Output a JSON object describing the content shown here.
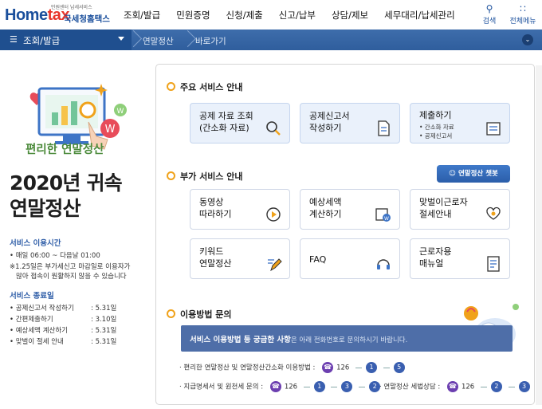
{
  "header": {
    "logo_tagline": "민원센터 납세서비스",
    "logo_brand_main": "Home",
    "logo_brand_accent": "tax",
    "logo_kr": "국세청홈택스",
    "menus": [
      "조회/발급",
      "민원증명",
      "신청/제출",
      "신고/납부",
      "상담/제보",
      "세무대리/납세관리"
    ],
    "search_label": "검색",
    "allmenu_label": "전체메뉴"
  },
  "nav": {
    "menu_label": "조회/발급",
    "crumb1": "연말정산",
    "crumb2": "바로가기"
  },
  "left": {
    "subtitle": "편리한 연말정산",
    "title_line1": "2020년 귀속",
    "title_line2": "연말정산",
    "service_hours_head": "서비스 이용시간",
    "hours": "• 매일 06:00 ~ 다음날 01:00",
    "note1": "※1.25일은 부가세신고 마감일로 이용자가",
    "note2": "많아 접속이 원활하지 않을 수 있습니다",
    "end_head": "서비스 종료일",
    "end_items": [
      {
        "label": "• 공제신고서 작성하기",
        "value": ": 5.31일"
      },
      {
        "label": "• 간편제출하기",
        "value": ": 3.10일"
      },
      {
        "label": "• 예상세액 계산하기",
        "value": ": 5.31일"
      },
      {
        "label": "• 맞벌이 절세 안내",
        "value": ": 5.31일"
      }
    ]
  },
  "main": {
    "sec1": "주요 서비스 안내",
    "cards1": [
      {
        "line1": "공제 자료 조회",
        "line2": "(간소화 자료)"
      },
      {
        "line1": "공제신고서",
        "line2": "작성하기"
      },
      {
        "line1": "제출하기",
        "bullet1": "• 간소화 자료",
        "bullet2": "• 공제신고서"
      }
    ],
    "sec2": "부가 서비스 안내",
    "chatbot": "연말정산 챗봇",
    "cards2": [
      {
        "line1": "동영상",
        "line2": "따라하기"
      },
      {
        "line1": "예상세액",
        "line2": "계산하기"
      },
      {
        "line1": "맞벌이근로자",
        "line2": "절세안내"
      },
      {
        "line1": "키워드",
        "line2": "연말정산"
      },
      {
        "line1": "FAQ",
        "line2": ""
      },
      {
        "line1": "근로자용",
        "line2": "매뉴얼"
      }
    ],
    "sec3": "이용방법 문의",
    "banner_bold": "서비스 이용방법 등 궁금한 사항",
    "banner_rest": "은 아래 전화번호로 문의하시기 바랍니다.",
    "phone1_label": "· 편리한 연말정산 및 연말정산간소화 이용방법 :",
    "phone2_label": "· 지급명세서 및 원천세 문의 :",
    "phone3_label": "· 연말정산 세법상담 :",
    "tel_main": "126",
    "phone1_digits": [
      "1",
      "5"
    ],
    "phone2_digits": [
      "1",
      "3",
      "2"
    ],
    "phone3_digits": [
      "2",
      "3"
    ]
  },
  "colors": {
    "brand_blue": "#1a4f9c",
    "nav_blue": "#2f5e9d",
    "accent_orange": "#f0a21a",
    "green": "#4b8a3a"
  }
}
